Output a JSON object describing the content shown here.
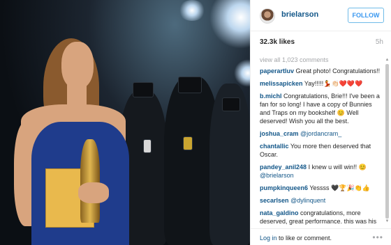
{
  "post": {
    "username": "brielarson",
    "follow_label": "FOLLOW",
    "likes": "32.3k likes",
    "age": "5h",
    "view_all": "view all 1,023 comments"
  },
  "comments": [
    {
      "user": "paperartluv",
      "text": "Great photo! Congratulations!!"
    },
    {
      "user": "melissapicken",
      "text": "Yay!!!!!💃👏🏻❤️❤️❤️"
    },
    {
      "user": "b.michl",
      "text": "Congratulations, Brie!!! I've been a fan for so long! I have a copy of Bunnies and Traps on my bookshelf 😊 Well deserved! Wish you all the best."
    },
    {
      "user": "joshua_cram",
      "mention": "@jordancram_",
      "text": ""
    },
    {
      "user": "chantallic",
      "text": "You more then deserved that Oscar."
    },
    {
      "user": "pandey_anil248",
      "text": "I knew u will win!! 😊",
      "mention": "@brielarson"
    },
    {
      "user": "pumpkinqueen6",
      "text": "Yessss 🖤🏆🎉👏👍"
    },
    {
      "user": "secarlsen",
      "mention": "@dylinquent",
      "text": ""
    },
    {
      "user": "nata_galdino",
      "text": "congratulations, more deserved, great performance. this was his Oscar."
    }
  ],
  "footer": {
    "login_link": "Log in",
    "login_rest": " to like or comment.",
    "more": "•••"
  }
}
